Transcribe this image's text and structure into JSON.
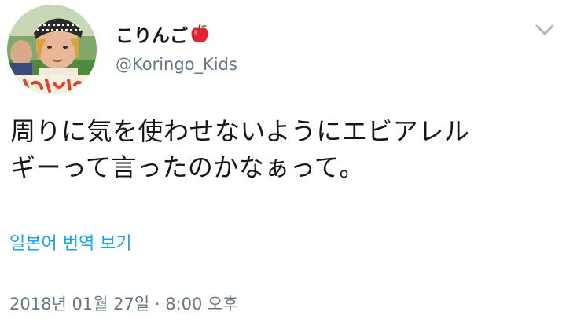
{
  "user": {
    "display_name": "こりんご",
    "name_emoji": "apple-emoji",
    "handle": "@Koringo_Kids"
  },
  "tweet": {
    "text_lines": [
      "周りに気を使わせないようにエビアレル",
      "ギーって言ったのかなぁって。"
    ],
    "translate_label": "일본어 번역 보기",
    "timestamp": "2018년 01월 27일 · 8:00 오후"
  },
  "icons": {
    "menu": "chevron-down-icon"
  },
  "colors": {
    "text": "#14171a",
    "secondary": "#657786",
    "link": "#1da1f2",
    "chevron": "#aab8c2",
    "apple": "#e0242f"
  }
}
